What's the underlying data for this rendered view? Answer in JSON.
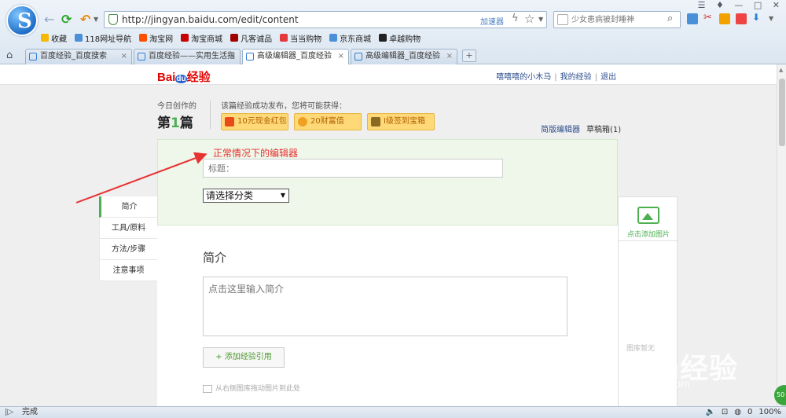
{
  "browser": {
    "url": "http://jingyan.baidu.com/edit/content",
    "accelerator_label": "加速器",
    "search_placeholder": "少女患病被封睡神",
    "bookmarks": [
      {
        "label": "收藏",
        "color": "#f5b800"
      },
      {
        "label": "118网址导航",
        "color": "#4a90d9"
      },
      {
        "label": "淘宝网",
        "color": "#ff5000"
      },
      {
        "label": "淘宝商城",
        "color": "#c40000"
      },
      {
        "label": "凡客诚品",
        "color": "#a00000"
      },
      {
        "label": "当当购物",
        "color": "#e4393c"
      },
      {
        "label": "京东商城",
        "color": "#4a90d9"
      },
      {
        "label": "卓越购物",
        "color": "#222222"
      }
    ],
    "tabs": [
      {
        "label": "百度经验_百度搜索",
        "active": false
      },
      {
        "label": "百度经验——实用生活指",
        "active": false
      },
      {
        "label": "高级编辑器_百度经验",
        "active": true
      },
      {
        "label": "高级编辑器_百度经验",
        "active": false
      }
    ],
    "new_tab_label": "+",
    "status_text": "完成",
    "status_count": "0",
    "zoom": "100%",
    "float_ball": "50"
  },
  "page": {
    "logo_text": "Bai",
    "logo_du": "du",
    "logo_suffix": "经验",
    "header_links": [
      "嘻嘻嘻的小木马",
      "我的经验",
      "退出"
    ],
    "today_label": "今日创作的",
    "today_count_prefix": "第",
    "today_count_num": "1",
    "today_count_suffix": "篇",
    "reward_intro": "该篇经验成功发布，您将可能获得：",
    "rewards": [
      {
        "label": "10元现金红包",
        "icon_color": "#e84a1a"
      },
      {
        "label": "20财富值",
        "icon_color": "#f0a020"
      },
      {
        "label": "I级签到宝箱",
        "icon_color": "#8a6a20"
      }
    ],
    "simple_editor_link": "简版编辑器",
    "drafts_link": "草稿箱(1)",
    "annotation": "正常情况下的编辑器",
    "title_placeholder": "标题：",
    "category_value": "请选择分类",
    "nav_items": [
      "简介",
      "工具/原料",
      "方法/步骤",
      "注意事项"
    ],
    "section_title": "简介",
    "intro_placeholder": "点击这里输入简介",
    "add_ref_button": "+ 添加经验引用",
    "drag_hint": "从右侧图库拖动图片到此处",
    "add_image_label": "点击添加图片",
    "gallery_empty": "图库暂无",
    "watermark": "Baidu经验",
    "watermark_sub": "jingyan.baidu.com"
  },
  "colors": {
    "accent_green": "#4caf50",
    "annotation_red": "#e83232",
    "link_blue": "#2b4c8c"
  }
}
